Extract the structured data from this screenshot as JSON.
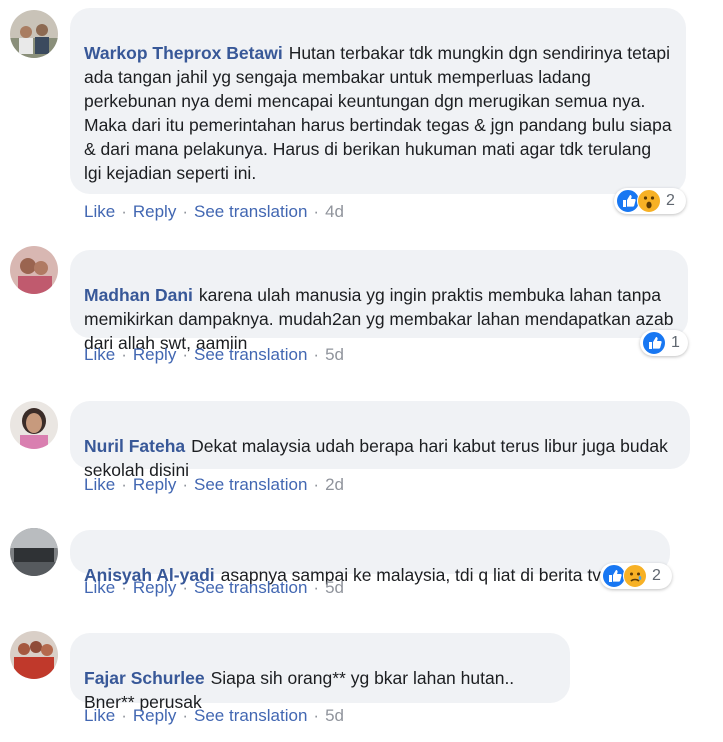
{
  "actions": {
    "like": "Like",
    "reply": "Reply",
    "see_translation": "See translation",
    "separator": "·"
  },
  "comments": [
    {
      "author": "Warkop Theprox Betawi",
      "text": "Hutan terbakar tdk mungkin dgn sendirinya tetapi ada tangan jahil yg sengaja membakar untuk memperluas ladang perkebunan nya demi mencapai keuntungan dgn merugikan semua nya. Maka dari itu pemerintahan harus bertindak tegas & jgn pandang bulu siapa & dari mana pelakunya. Harus di berikan hukuman mati agar tdk terulang lgi kejadian seperti ini.",
      "time": "4d",
      "reactions": {
        "icons": [
          "like-icon",
          "wow-icon"
        ],
        "count": "2"
      }
    },
    {
      "author": "Madhan Dani",
      "text": "karena ulah manusia yg ingin praktis membuka lahan tanpa memikirkan dampaknya. mudah2an yg membakar lahan mendapatkan azab dari allah swt, aamiin",
      "time": "5d",
      "reactions": {
        "icons": [
          "like-icon"
        ],
        "count": "1"
      }
    },
    {
      "author": "Nuril Fateha",
      "text": "Dekat malaysia udah berapa hari kabut terus libur juga budak sekolah disini",
      "time": "2d"
    },
    {
      "author": "Anisyah Al-yadi",
      "text": "asapnya sampai ke malaysia, tdi q liat di berita tv",
      "time": "5d",
      "reactions": {
        "icons": [
          "like-icon",
          "sad-icon"
        ],
        "count": "2"
      }
    },
    {
      "author": "Fajar Schurlee",
      "text": "Siapa sih orang** yg bkar lahan hutan..\nBner** perusak",
      "time": "5d"
    }
  ],
  "colors": {
    "author": "#385898",
    "link": "#4267b2",
    "bubble": "#f0f2f5",
    "like_blue": "#1877f2",
    "reaction_yellow": "#f7b125"
  }
}
